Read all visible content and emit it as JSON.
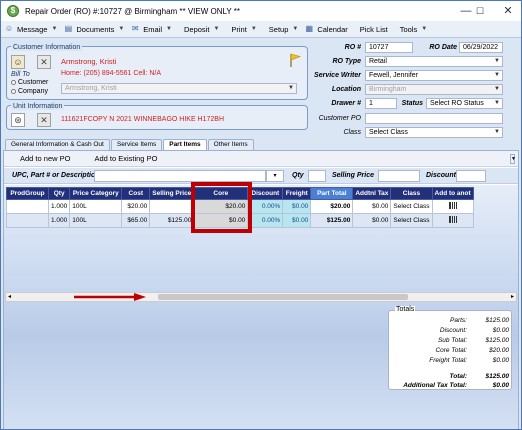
{
  "window": {
    "title": "Repair Order (RO) #:10727 @ Birmingham ** VIEW ONLY **",
    "minimize": "—",
    "maximize": "☐",
    "close": "✕"
  },
  "menu": [
    {
      "label": "Message",
      "icon": "message-icon",
      "glyph": "☺",
      "dropdown": true
    },
    {
      "label": "Documents",
      "icon": "documents-icon",
      "glyph": "▤",
      "dropdown": true
    },
    {
      "label": "Email",
      "icon": "email-icon",
      "glyph": "✉",
      "dropdown": true
    },
    {
      "label": "Deposit",
      "dropdown": true
    },
    {
      "label": "Print",
      "dropdown": true
    },
    {
      "label": "Setup",
      "dropdown": true
    },
    {
      "label": "Calendar",
      "icon": "calendar-icon",
      "glyph": "▦",
      "dropdown": false
    },
    {
      "label": "Pick List",
      "dropdown": false
    },
    {
      "label": "Tools",
      "dropdown": true
    }
  ],
  "customer": {
    "group_label": "Customer Information",
    "name": "Armstrong, Kristi",
    "phone": "Home: (205) 894-5561 Cell: N/A",
    "bill_to_label": "Bill To",
    "opt_customer": "Customer",
    "opt_company": "Company",
    "bill_to_value": "Armstrong, Kristi"
  },
  "unit": {
    "group_label": "Unit Information",
    "value": "111621FCOPY N 2021 WINNEBAGO HIKE H172BH"
  },
  "ro": {
    "ro_num_label": "RO #",
    "ro_num": "10727",
    "ro_date_label": "RO Date",
    "ro_date": "06/29/2022",
    "ro_type_label": "RO Type",
    "ro_type": "Retail",
    "writer_label": "Service Writer",
    "writer": "Fewell, Jennifer",
    "location_label": "Location",
    "location": "Birmingham",
    "drawer_label": "Drawer #",
    "drawer": "1",
    "status_label": "Status",
    "status": "Select RO Status",
    "custpo_label": "Customer PO",
    "custpo": "",
    "class_label": "Class",
    "class_value": "Select Class"
  },
  "tabs": [
    "General Information & Cash Out",
    "Service Items",
    "Part Items",
    "Other Items"
  ],
  "active_tab": 2,
  "subtoolbar": {
    "add_new": "Add to new PO",
    "add_existing": "Add to Existing PO"
  },
  "search": {
    "upc_label": "UPC, Part # or Description",
    "qty_label": "Qty",
    "price_label": "Selling Price",
    "discount_label": "Discount"
  },
  "grid": {
    "headers": [
      "ProdGroup",
      "Qty",
      "Price Category",
      "Cost",
      "Selling Price",
      "Core",
      "Discount",
      "Freight",
      "Part Total",
      "Addtnl Tax",
      "Class",
      "Add to anot"
    ],
    "rows": [
      [
        "",
        "1.000",
        "100L",
        "$20.00",
        "",
        "$20.00",
        "0.00%",
        "$0.00",
        "$20.00",
        "$0.00",
        "Select Class",
        ""
      ],
      [
        "",
        "1.000",
        "100L",
        "$65.00",
        "$125.00",
        "$0.00",
        "0.00%",
        "$0.00",
        "$125.00",
        "$0.00",
        "Select Class",
        ""
      ]
    ]
  },
  "totals": {
    "group_label": "Totals",
    "rows": [
      {
        "k": "Parts:",
        "v": "$125.00"
      },
      {
        "k": "Discount:",
        "v": "$0.00"
      },
      {
        "k": "Sub Total:",
        "v": "$125.00"
      },
      {
        "k": "Core Total:",
        "v": "$20.00"
      },
      {
        "k": "Freight Total:",
        "v": "$0.00"
      },
      {
        "k": "Total:",
        "v": "$125.00",
        "bold": true
      },
      {
        "k": "Additional Tax Total:",
        "v": "$0.00",
        "bold": true
      }
    ]
  },
  "colors": {
    "highlight_box": "#c00000",
    "arrow": "#c00000",
    "header": "#22307a",
    "active_header": "#4a7fd4"
  }
}
